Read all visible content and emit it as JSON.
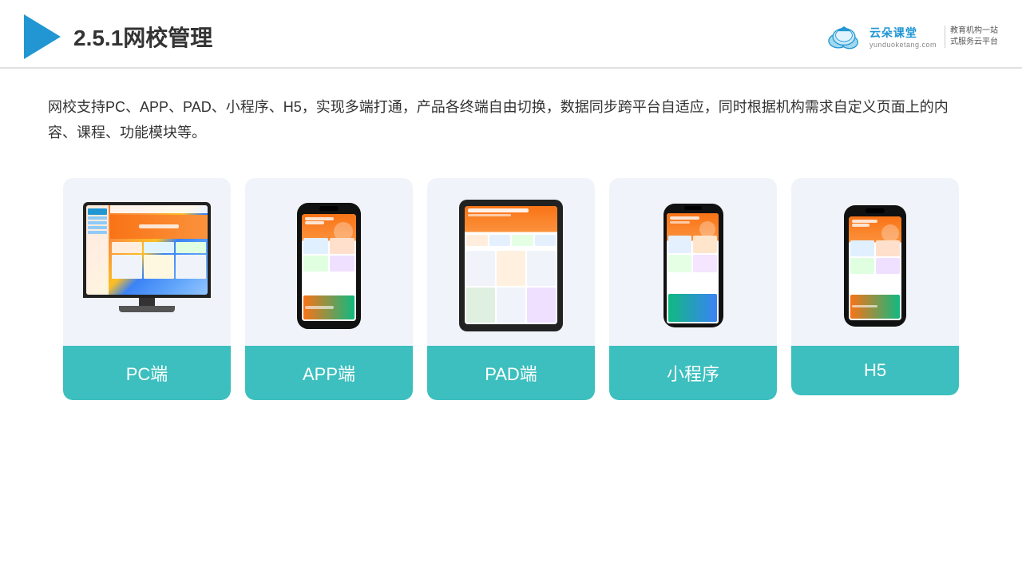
{
  "header": {
    "title": "2.5.1网校管理",
    "brand": {
      "name": "云朵课堂",
      "url": "yunduoketang.com",
      "tagline": "教育机构一站\n式服务云平台"
    }
  },
  "description": {
    "text": "网校支持PC、APP、PAD、小程序、H5，实现多端打通，产品各终端自由切换，数据同步跨平台自适应，同时根据机构需求自定义页面上的内容、课程、功能模块等。"
  },
  "cards": [
    {
      "label": "PC端",
      "type": "pc"
    },
    {
      "label": "APP端",
      "type": "phone"
    },
    {
      "label": "PAD端",
      "type": "tablet"
    },
    {
      "label": "小程序",
      "type": "mini-phone"
    },
    {
      "label": "H5",
      "type": "phone2"
    }
  ],
  "colors": {
    "accent": "#3cbfbe",
    "accent_dark": "#2aa6a5",
    "brand_blue": "#2196d3",
    "text_dark": "#333333",
    "bg_card": "#f0f4fa"
  }
}
